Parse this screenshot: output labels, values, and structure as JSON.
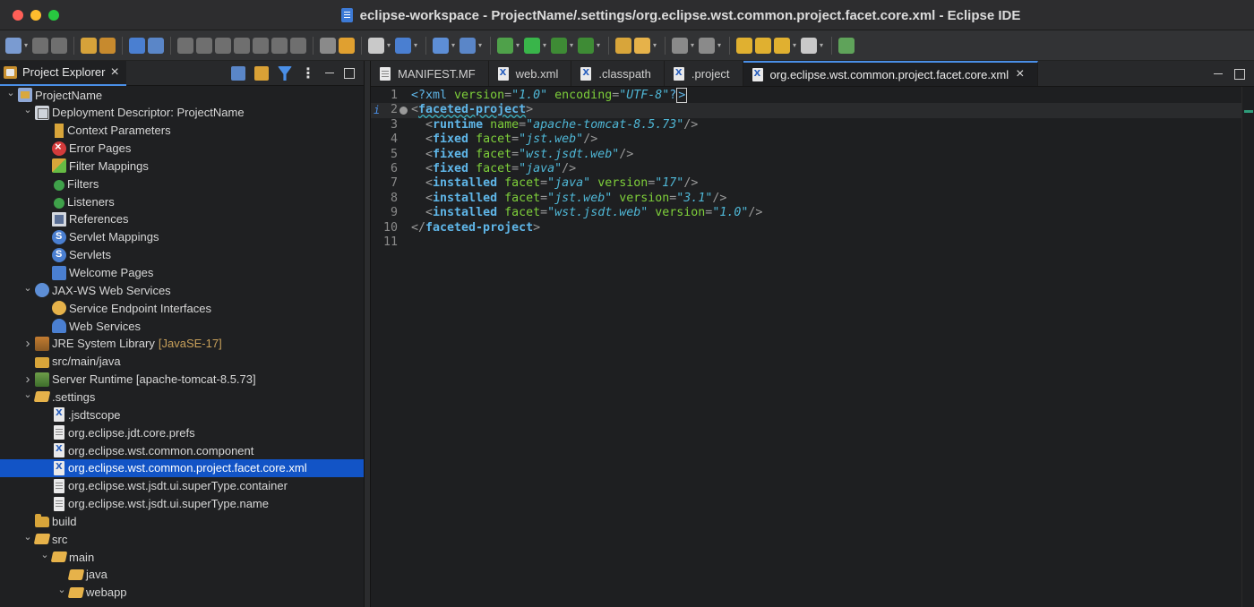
{
  "window": {
    "title": "eclipse-workspace - ProjectName/.settings/org.eclipse.wst.common.project.facet.core.xml - Eclipse IDE"
  },
  "colors": {
    "accent": "#4a8fe7",
    "selection": "#1254c6",
    "xml_tag": "#5fb6e8",
    "xml_attr": "#7ecf3a",
    "xml_value": "#4fb7d6"
  },
  "project_explorer": {
    "tab_label": "Project Explorer",
    "tree": [
      {
        "label": "ProjectName",
        "depth": 0,
        "expander": "open",
        "icon": "project-icon"
      },
      {
        "label": "Deployment Descriptor: ProjectName",
        "depth": 1,
        "expander": "open",
        "icon": "deployment-descriptor-icon"
      },
      {
        "label": "Context Parameters",
        "depth": 2,
        "expander": "none",
        "icon": "context-params-icon"
      },
      {
        "label": "Error Pages",
        "depth": 2,
        "expander": "none",
        "icon": "error-pages-icon"
      },
      {
        "label": "Filter Mappings",
        "depth": 2,
        "expander": "none",
        "icon": "filter-mappings-icon"
      },
      {
        "label": "Filters",
        "depth": 2,
        "expander": "none",
        "icon": "filters-icon"
      },
      {
        "label": "Listeners",
        "depth": 2,
        "expander": "none",
        "icon": "listeners-icon"
      },
      {
        "label": "References",
        "depth": 2,
        "expander": "none",
        "icon": "references-icon"
      },
      {
        "label": "Servlet Mappings",
        "depth": 2,
        "expander": "none",
        "icon": "servlet-mappings-icon"
      },
      {
        "label": "Servlets",
        "depth": 2,
        "expander": "none",
        "icon": "servlets-icon"
      },
      {
        "label": "Welcome Pages",
        "depth": 2,
        "expander": "none",
        "icon": "welcome-pages-icon"
      },
      {
        "label": "JAX-WS Web Services",
        "depth": 1,
        "expander": "open",
        "icon": "jaxws-icon"
      },
      {
        "label": "Service Endpoint Interfaces",
        "depth": 2,
        "expander": "none",
        "icon": "service-endpoint-icon"
      },
      {
        "label": "Web Services",
        "depth": 2,
        "expander": "none",
        "icon": "web-services-icon"
      },
      {
        "label": "JRE System Library",
        "decoration": "[JavaSE-17]",
        "depth": 1,
        "expander": "closed",
        "icon": "library-icon"
      },
      {
        "label": "src/main/java",
        "depth": 1,
        "expander": "none",
        "icon": "source-folder-icon"
      },
      {
        "label": "Server Runtime [apache-tomcat-8.5.73]",
        "depth": 1,
        "expander": "closed",
        "icon": "server-runtime-icon"
      },
      {
        "label": ".settings",
        "depth": 1,
        "expander": "open",
        "icon": "folder-open-icon"
      },
      {
        "label": ".jsdtscope",
        "depth": 2,
        "expander": "none",
        "icon": "xml-file-icon"
      },
      {
        "label": "org.eclipse.jdt.core.prefs",
        "depth": 2,
        "expander": "none",
        "icon": "text-file-icon"
      },
      {
        "label": "org.eclipse.wst.common.component",
        "depth": 2,
        "expander": "none",
        "icon": "xml-file-icon"
      },
      {
        "label": "org.eclipse.wst.common.project.facet.core.xml",
        "depth": 2,
        "expander": "none",
        "icon": "xml-file-icon",
        "selected": true
      },
      {
        "label": "org.eclipse.wst.jsdt.ui.superType.container",
        "depth": 2,
        "expander": "none",
        "icon": "text-file-icon"
      },
      {
        "label": "org.eclipse.wst.jsdt.ui.superType.name",
        "depth": 2,
        "expander": "none",
        "icon": "text-file-icon"
      },
      {
        "label": "build",
        "depth": 1,
        "expander": "none",
        "icon": "folder-icon"
      },
      {
        "label": "src",
        "depth": 1,
        "expander": "open",
        "icon": "folder-open-icon"
      },
      {
        "label": "main",
        "depth": 2,
        "expander": "open",
        "icon": "folder-open-icon"
      },
      {
        "label": "java",
        "depth": 3,
        "expander": "none",
        "icon": "folder-open-icon"
      },
      {
        "label": "webapp",
        "depth": 3,
        "expander": "open",
        "icon": "folder-open-icon"
      }
    ]
  },
  "editor": {
    "tabs": [
      {
        "label": "MANIFEST.MF",
        "icon": "manifest-file-icon",
        "active": false
      },
      {
        "label": "web.xml",
        "icon": "xml-file-icon",
        "active": false
      },
      {
        "label": ".classpath",
        "icon": "xml-file-icon",
        "active": false
      },
      {
        "label": ".project",
        "icon": "xml-file-icon",
        "active": false
      },
      {
        "label": "org.eclipse.wst.common.project.facet.core.xml",
        "icon": "xml-file-icon",
        "active": true
      }
    ],
    "lines": [
      {
        "n": "1",
        "tokens": [
          [
            "pi",
            "<?xml "
          ],
          [
            "attr",
            "version"
          ],
          [
            "punct",
            "="
          ],
          [
            "val",
            "\"1.0\""
          ],
          [
            "punct",
            " "
          ],
          [
            "attr",
            "encoding"
          ],
          [
            "punct",
            "="
          ],
          [
            "val",
            "\"UTF-8\""
          ],
          [
            "pi",
            "?"
          ],
          [
            "caret",
            ">"
          ]
        ]
      },
      {
        "n": "2",
        "current": true,
        "info": "i",
        "fold": true,
        "tokens": [
          [
            "punct",
            "<"
          ],
          [
            "tagsq",
            "faceted-project"
          ],
          [
            "punct",
            ">"
          ]
        ]
      },
      {
        "n": "3",
        "tokens": [
          [
            "punct",
            "  <"
          ],
          [
            "tag",
            "runtime"
          ],
          [
            "punct",
            " "
          ],
          [
            "attr",
            "name"
          ],
          [
            "punct",
            "="
          ],
          [
            "val",
            "\"apache-tomcat-8.5.73\""
          ],
          [
            "punct",
            "/>"
          ]
        ]
      },
      {
        "n": "4",
        "tokens": [
          [
            "punct",
            "  <"
          ],
          [
            "tag",
            "fixed"
          ],
          [
            "punct",
            " "
          ],
          [
            "attr",
            "facet"
          ],
          [
            "punct",
            "="
          ],
          [
            "val",
            "\"jst.web\""
          ],
          [
            "punct",
            "/>"
          ]
        ]
      },
      {
        "n": "5",
        "tokens": [
          [
            "punct",
            "  <"
          ],
          [
            "tag",
            "fixed"
          ],
          [
            "punct",
            " "
          ],
          [
            "attr",
            "facet"
          ],
          [
            "punct",
            "="
          ],
          [
            "val",
            "\"wst.jsdt.web\""
          ],
          [
            "punct",
            "/>"
          ]
        ]
      },
      {
        "n": "6",
        "tokens": [
          [
            "punct",
            "  <"
          ],
          [
            "tag",
            "fixed"
          ],
          [
            "punct",
            " "
          ],
          [
            "attr",
            "facet"
          ],
          [
            "punct",
            "="
          ],
          [
            "val",
            "\"java\""
          ],
          [
            "punct",
            "/>"
          ]
        ]
      },
      {
        "n": "7",
        "tokens": [
          [
            "punct",
            "  <"
          ],
          [
            "tag",
            "installed"
          ],
          [
            "punct",
            " "
          ],
          [
            "attr",
            "facet"
          ],
          [
            "punct",
            "="
          ],
          [
            "val",
            "\"java\""
          ],
          [
            "punct",
            " "
          ],
          [
            "attr",
            "version"
          ],
          [
            "punct",
            "="
          ],
          [
            "val",
            "\"17\""
          ],
          [
            "punct",
            "/>"
          ]
        ]
      },
      {
        "n": "8",
        "tokens": [
          [
            "punct",
            "  <"
          ],
          [
            "tag",
            "installed"
          ],
          [
            "punct",
            " "
          ],
          [
            "attr",
            "facet"
          ],
          [
            "punct",
            "="
          ],
          [
            "val",
            "\"jst.web\""
          ],
          [
            "punct",
            " "
          ],
          [
            "attr",
            "version"
          ],
          [
            "punct",
            "="
          ],
          [
            "val",
            "\"3.1\""
          ],
          [
            "punct",
            "/>"
          ]
        ]
      },
      {
        "n": "9",
        "tokens": [
          [
            "punct",
            "  <"
          ],
          [
            "tag",
            "installed"
          ],
          [
            "punct",
            " "
          ],
          [
            "attr",
            "facet"
          ],
          [
            "punct",
            "="
          ],
          [
            "val",
            "\"wst.jsdt.web\""
          ],
          [
            "punct",
            " "
          ],
          [
            "attr",
            "version"
          ],
          [
            "punct",
            "="
          ],
          [
            "val",
            "\"1.0\""
          ],
          [
            "punct",
            "/>"
          ]
        ]
      },
      {
        "n": "10",
        "tokens": [
          [
            "punct",
            "</"
          ],
          [
            "tag",
            "faceted-project"
          ],
          [
            "punct",
            ">"
          ]
        ]
      },
      {
        "n": "11",
        "tokens": []
      }
    ]
  }
}
